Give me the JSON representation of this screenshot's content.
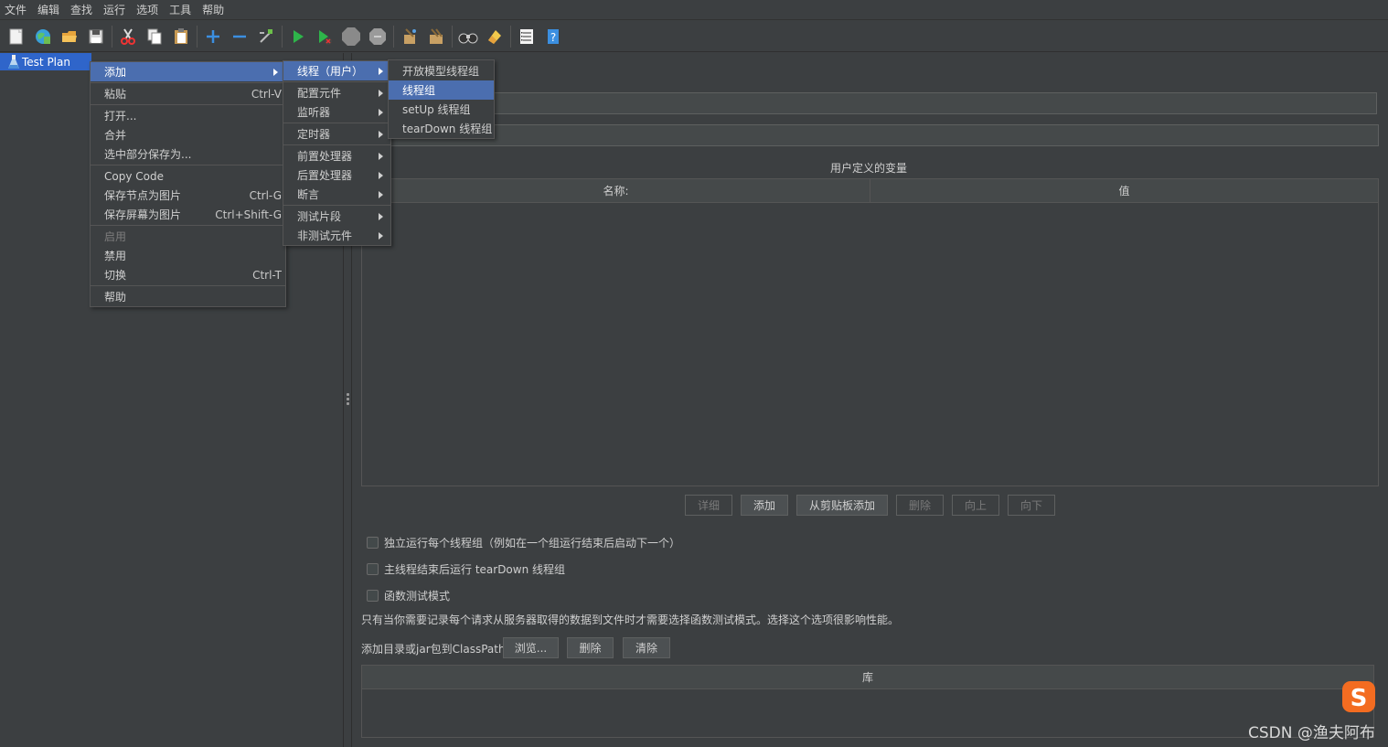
{
  "menubar": [
    "文件",
    "编辑",
    "查找",
    "运行",
    "选项",
    "工具",
    "帮助"
  ],
  "toolbar": {
    "icons": [
      "new-icon",
      "templates-icon",
      "open-icon",
      "save-icon",
      "cut-icon",
      "copy-icon",
      "paste-icon",
      "expand-icon",
      "collapse-icon",
      "toggle-icon",
      "start-icon",
      "start-no-pause-icon",
      "stop-icon",
      "shutdown-icon",
      "clear-icon",
      "clear-all-icon",
      "search-icon",
      "reset-search-icon",
      "function-helper-icon",
      "help-icon"
    ]
  },
  "tree": {
    "root_label": "Test Plan"
  },
  "context_menu": {
    "items": [
      {
        "label": "添加",
        "accel": "",
        "submenu": true,
        "selected": true
      },
      {
        "label": "粘贴",
        "accel": "Ctrl-V"
      },
      {
        "label": "打开...",
        "accel": ""
      },
      {
        "label": "合并",
        "accel": ""
      },
      {
        "label": "选中部分保存为...",
        "accel": ""
      },
      {
        "label": "Copy Code",
        "accel": ""
      },
      {
        "label": "保存节点为图片",
        "accel": "Ctrl-G"
      },
      {
        "label": "保存屏幕为图片",
        "accel": "Ctrl+Shift-G"
      },
      {
        "label": "启用",
        "accel": "",
        "disabled": true
      },
      {
        "label": "禁用",
        "accel": ""
      },
      {
        "label": "切换",
        "accel": "Ctrl-T"
      },
      {
        "label": "帮助",
        "accel": ""
      }
    ]
  },
  "submenu_add": {
    "items": [
      "线程（用户）",
      "配置元件",
      "监听器",
      "定时器",
      "前置处理器",
      "后置处理器",
      "断言",
      "测试片段",
      "非测试元件"
    ]
  },
  "submenu_threads": {
    "items": [
      "开放模型线程组",
      "线程组",
      "setUp 线程组",
      "tearDown 线程组"
    ]
  },
  "main": {
    "vars_title": "用户定义的变量",
    "table_headers": [
      "名称:",
      "值"
    ],
    "buttons": [
      "详细",
      "添加",
      "从剪贴板添加",
      "删除",
      "向上",
      "向下"
    ],
    "checkboxes": [
      {
        "label": "独立运行每个线程组（例如在一个组运行结束后启动下一个）",
        "checked": false
      },
      {
        "label": "主线程结束后运行 tearDown 线程组",
        "checked": false
      },
      {
        "label": "函数测试模式",
        "checked": false
      }
    ],
    "note": "只有当你需要记录每个请求从服务器取得的数据到文件时才需要选择函数测试模式。选择这个选项很影响性能。",
    "classpath_label": "添加目录或jar包到ClassPath",
    "classpath_buttons": [
      "浏览...",
      "删除",
      "清除"
    ],
    "lib_header": "库"
  },
  "watermark": "CSDN @渔夫阿布",
  "colors": {
    "background": "#3c3f41",
    "selection": "#4b6eaf",
    "tree_selection": "#2f65ca"
  }
}
